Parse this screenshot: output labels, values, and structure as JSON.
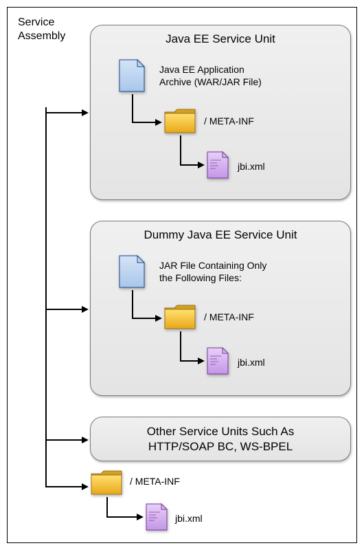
{
  "assembly_label": "Service\nAssembly",
  "unit1": {
    "title": "Java EE Service Unit",
    "archive_label": "Java EE Application\nArchive (WAR/JAR File)",
    "metainf_label": "/ META-INF",
    "jbi_label": "jbi.xml"
  },
  "unit2": {
    "title": "Dummy Java EE Service Unit",
    "archive_label": "JAR File Containing Only\nthe Following Files:",
    "metainf_label": "/ META-INF",
    "jbi_label": "jbi.xml"
  },
  "unit3": {
    "title": "Other Service Units Such As\nHTTP/SOAP BC, WS-BPEL"
  },
  "bottom": {
    "metainf_label": "/ META-INF",
    "jbi_label": "jbi.xml"
  }
}
